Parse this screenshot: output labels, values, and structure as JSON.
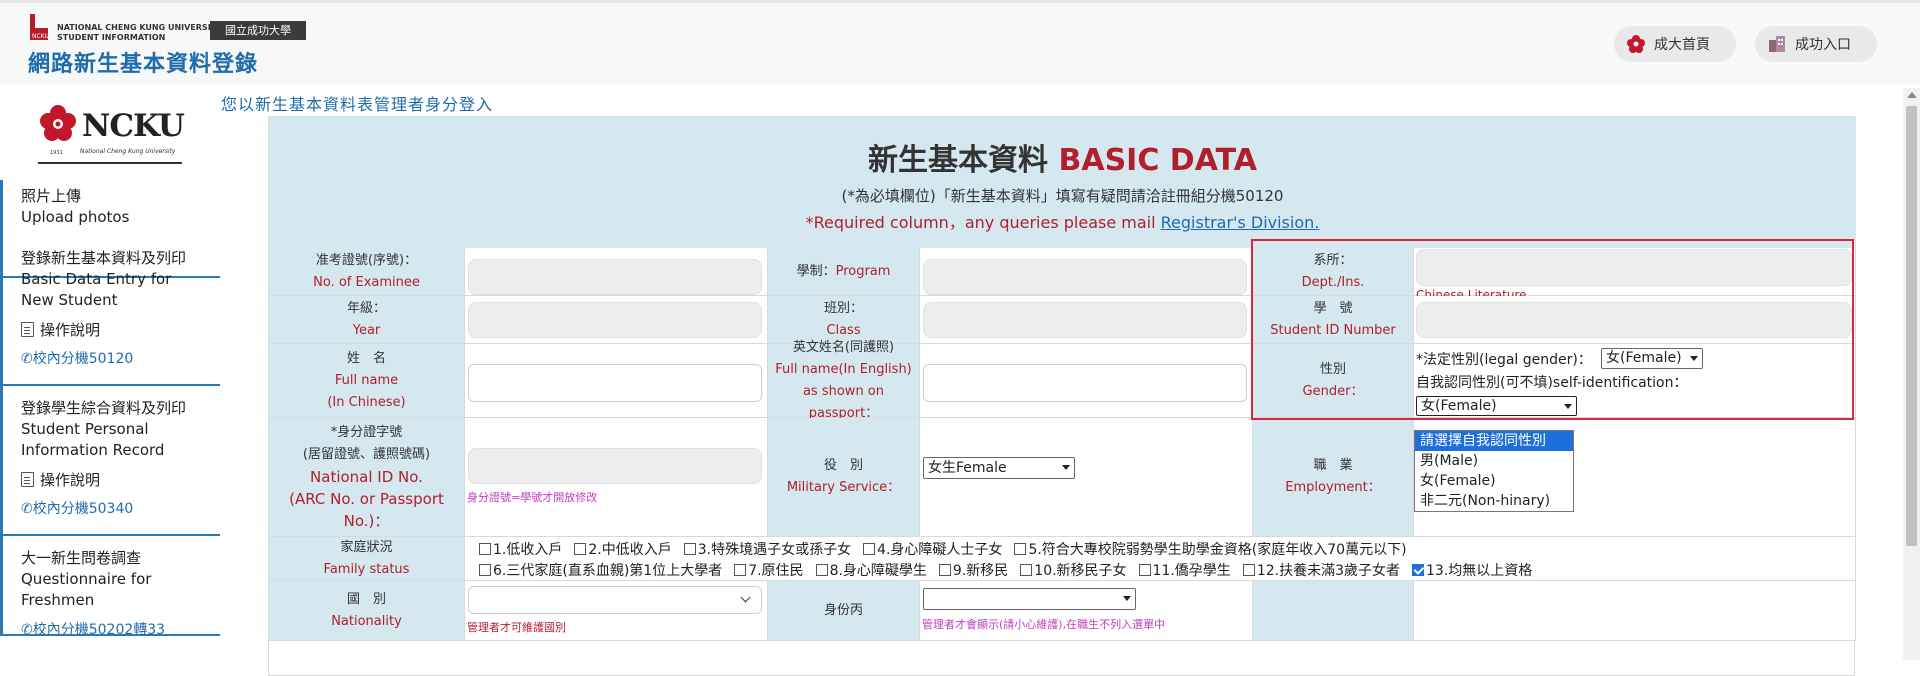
{
  "header": {
    "uni_line1": "NATIONAL CHENG KUNG UNIVERSITY",
    "uni_line2": "STUDENT INFORMATION",
    "calligraphy": "國立成功大學",
    "site_title": "網路新生基本資料登錄",
    "home_button": "成大首頁",
    "portal_button": "成功入口"
  },
  "sidebar": {
    "logo_text": "NCKU",
    "logo_sub": "National Cheng Kung University",
    "logo_year": "1931",
    "sections": [
      {
        "title_zh": "照片上傳",
        "title_en": "Upload photos"
      },
      {
        "title_zh": "登錄新生基本資料及列印",
        "title_en1": "Basic Data Entry for",
        "title_en2": "New Student",
        "sub": "操作說明",
        "phone": "校內分機50120"
      },
      {
        "title_zh": "登錄學生綜合資料及列印",
        "title_en1": "Student Personal",
        "title_en2": "Information Record",
        "sub": "操作說明",
        "phone": "校內分機50340"
      },
      {
        "title_zh": "大一新生問卷調查",
        "title_en1": "Questionnaire for",
        "title_en2": "Freshmen",
        "phone": "校內分機50202轉33"
      }
    ]
  },
  "login_message": "您以新生基本資料表管理者身分登入",
  "form": {
    "title_zh": "新生基本資料",
    "title_en": "BASIC DATA",
    "note1": "(*為必填欄位)「新生基本資料」填寫有疑問請洽註冊組分機50120",
    "note2_prefix": "*Required column，any queries please mail ",
    "note2_link": "Registrar's Division.",
    "labels": {
      "examinee_zh": "准考證號(序號)：",
      "examinee_en": "No. of Examinee",
      "program_zh": "學制：",
      "program_en": "Program",
      "dept_zh": "系所：",
      "dept_en": "Dept./Ins.",
      "year_zh": "年級：",
      "year_en": "Year",
      "class_zh": "班別：",
      "class_en": "Class",
      "sid_zh": "學　號",
      "sid_en": "Student ID Number",
      "name_zh": "姓　名",
      "name_en1": "Full name",
      "name_en2": "(In Chinese)",
      "ename_zh": "英文姓名(同護照)",
      "ename_en1": "Full name(In English)",
      "ename_en2": "as shown on passport：",
      "gender_zh": "性別",
      "gender_en": "Gender：",
      "id_zh1": "*身分證字號",
      "id_zh2": "(居留證號、護照號碼)",
      "id_en1": "National ID No.",
      "id_en2": "(ARC No. or Passport",
      "id_en3": "No.)：",
      "military_zh": "役　別",
      "military_en": "Military Service：",
      "employment_zh": "職　業",
      "employment_en": "Employment：",
      "family_zh": "家庭狀況",
      "family_en": "Family status",
      "nationality_zh": "國　別",
      "nationality_en": "Nationality",
      "identity_c": "身份丙"
    },
    "dept_value": "Chinese Literature",
    "id_hint": "身分證號=學號才開放修改",
    "military_value": "女生Female",
    "legal_gender_label": "*法定性別(legal gender)：",
    "legal_gender_value": "女(Female)",
    "self_id_label": "自我認同性別(可不填)self-identification：",
    "self_id_value": "女(Female)",
    "self_id_options": [
      "請選擇自我認同性別",
      "男(Male)",
      "女(Female)",
      "非二元(Non-hinary)"
    ],
    "self_id_highlighted": 0,
    "family_line1": [
      {
        "label": "1.低收入戶",
        "checked": false
      },
      {
        "label": "2.中低收入戶",
        "checked": false
      },
      {
        "label": "3.特殊境遇子女或孫子女",
        "checked": false
      },
      {
        "label": "4.身心障礙人士子女",
        "checked": false
      },
      {
        "label": "5.符合大專校院弱勢學生助學金資格(家庭年收入70萬元以下)",
        "checked": false
      }
    ],
    "family_line2": [
      {
        "label": "6.三代家庭(直系血親)第1位上大學者",
        "checked": false
      },
      {
        "label": "7.原住民",
        "checked": false
      },
      {
        "label": "8.身心障礙學生",
        "checked": false
      },
      {
        "label": "9.新移民",
        "checked": false
      },
      {
        "label": "10.新移民子女",
        "checked": false
      },
      {
        "label": "11.僑孕學生",
        "checked": false
      },
      {
        "label": "12.扶養未滿3歲子女者",
        "checked": false
      },
      {
        "label": "13.均無以上資格",
        "checked": true
      }
    ],
    "nationality_hint": "管理者才可維護國別",
    "identity_hint": "管理者才會顯示(請小心維護),在職生不列入選單中"
  },
  "colors": {
    "accent_blue": "#1f6cad",
    "label_bg": "#d5e7ef",
    "required_red": "#b01f2b",
    "highlight_box": "#d6283a"
  }
}
